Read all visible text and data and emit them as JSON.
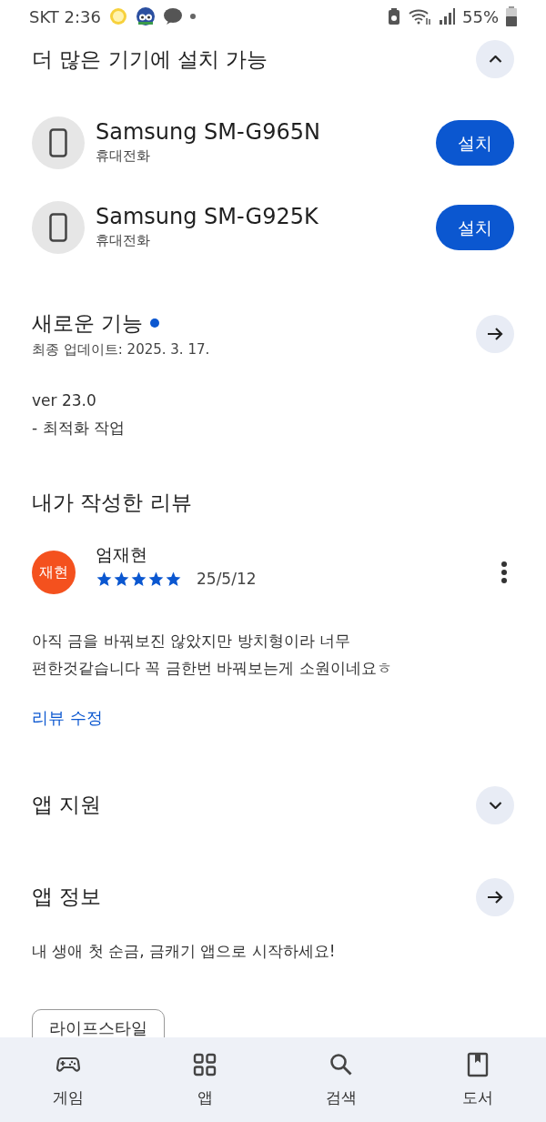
{
  "status_bar": {
    "carrier_time": "SKT 2:36",
    "battery_text": "55%"
  },
  "devices_section": {
    "title": "더 많은 기기에 설치 가능",
    "expanded": true,
    "devices": [
      {
        "name": "Samsung SM-G965N",
        "type": "휴대전화",
        "button": "설치"
      },
      {
        "name": "Samsung SM-G925K",
        "type": "휴대전화",
        "button": "설치"
      }
    ]
  },
  "whats_new": {
    "title": "새로운 기능",
    "updated": "최종 업데이트: 2025. 3. 17.",
    "lines": [
      "ver 23.0",
      "- 최적화 작업"
    ]
  },
  "my_review": {
    "title": "내가 작성한 리뷰",
    "avatar_text": "재현",
    "author": "엄재현",
    "stars": 5,
    "date": "25/5/12",
    "text": "아직 금을 바꿔보진 않았지만 방치형이라 너무\n편한것같습니다 꼭 금한번 바꿔보는게 소원이네요ㅎ",
    "edit_link": "리뷰 수정"
  },
  "app_support": {
    "title": "앱 지원",
    "expanded": false
  },
  "app_info": {
    "title": "앱 정보",
    "description": "내 생애 첫 순금, 금캐기 앱으로 시작하세요!",
    "chips": [
      "라이프스타일"
    ]
  },
  "bottom_nav": [
    {
      "kind": "games",
      "label": "게임"
    },
    {
      "kind": "apps",
      "label": "앱"
    },
    {
      "kind": "search",
      "label": "검색"
    },
    {
      "kind": "books",
      "label": "도서"
    }
  ]
}
